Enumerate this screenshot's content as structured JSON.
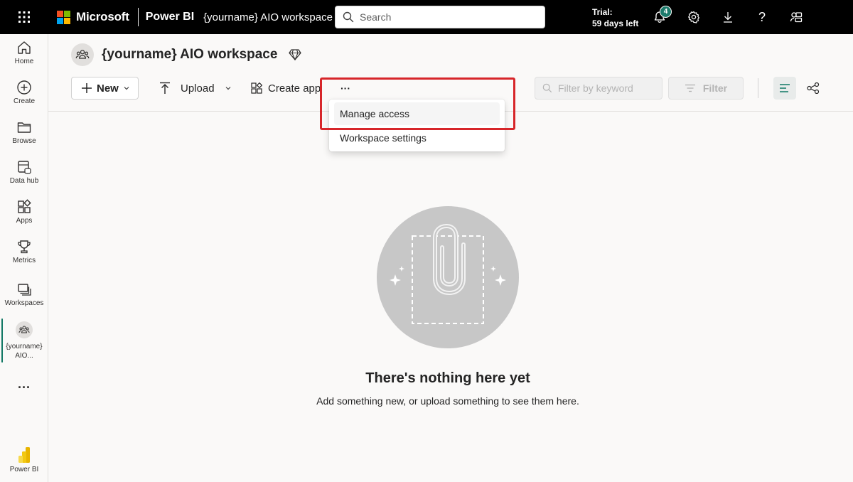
{
  "topbar": {
    "brand": "Microsoft",
    "app": "Power BI",
    "workspace_crumb": "{yourname} AIO workspace",
    "search_placeholder": "Search",
    "trial_line1": "Trial:",
    "trial_line2": "59 days left",
    "notification_count": "4",
    "icons": [
      "waffle-icon",
      "bell-icon",
      "gear-icon",
      "download-icon",
      "help-icon",
      "feedback-icon"
    ]
  },
  "nav": {
    "items": [
      {
        "label": "Home",
        "icon": "home-icon"
      },
      {
        "label": "Create",
        "icon": "create-icon"
      },
      {
        "label": "Browse",
        "icon": "folder-icon"
      },
      {
        "label": "Data hub",
        "icon": "data-hub-icon"
      },
      {
        "label": "Apps",
        "icon": "apps-icon"
      },
      {
        "label": "Metrics",
        "icon": "trophy-icon"
      },
      {
        "label": "Workspaces",
        "icon": "workspaces-icon"
      },
      {
        "label_line1": "{yourname}",
        "label_line2": "AIO...",
        "icon": "workspace-people-icon"
      },
      {
        "label": "...",
        "icon": "more-icon"
      },
      {
        "label": "Power BI",
        "icon": "powerbi-logo-icon"
      }
    ],
    "accent": "#117865"
  },
  "workspace": {
    "title": "{yourname} AIO workspace"
  },
  "toolbar": {
    "new_label": "New",
    "upload_label": "Upload",
    "create_app_label": "Create app",
    "more_label": "···",
    "filter_placeholder": "Filter by keyword",
    "filter_label": "Filter"
  },
  "menu": {
    "items": [
      "Manage access",
      "Workspace settings"
    ],
    "highlight_color": "#d7262a"
  },
  "empty_state": {
    "title": "There's nothing here yet",
    "subtitle": "Add something new, or upload something to see them here."
  }
}
